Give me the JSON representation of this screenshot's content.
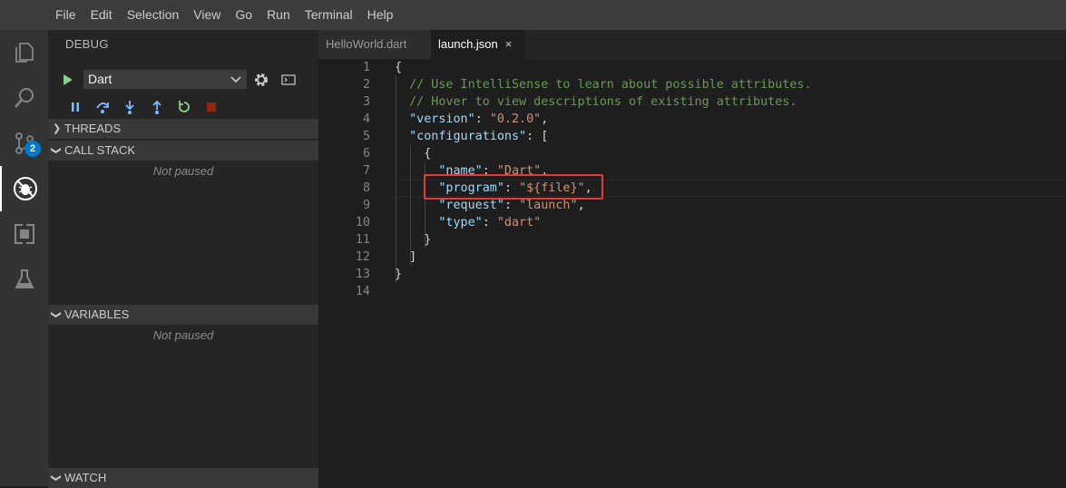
{
  "menu": [
    "File",
    "Edit",
    "Selection",
    "View",
    "Go",
    "Run",
    "Terminal",
    "Help"
  ],
  "activity": {
    "scm_badge": "2"
  },
  "sidebar": {
    "title": "DEBUG",
    "config_selected": "Dart",
    "sections": {
      "threads": "THREADS",
      "call_stack": "CALL STACK",
      "call_stack_status": "Not paused",
      "variables": "VARIABLES",
      "variables_status": "Not paused",
      "watch": "WATCH"
    }
  },
  "tabs": [
    {
      "label": "HelloWorld.dart",
      "active": false
    },
    {
      "label": "launch.json",
      "active": true,
      "close": "×"
    }
  ],
  "editor": {
    "line_numbers": [
      "1",
      "2",
      "3",
      "4",
      "5",
      "6",
      "7",
      "8",
      "9",
      "10",
      "11",
      "12",
      "13",
      "14"
    ],
    "lines": [
      "{",
      "  // Use IntelliSense to learn about possible attributes.",
      "  // Hover to view descriptions of existing attributes.",
      "  \"version\": \"0.2.0\",",
      "  \"configurations\": [",
      "    {",
      "      \"name\": \"Dart\",",
      "      \"program\": \"${file}\",",
      "      \"request\": \"launch\",",
      "      \"type\": \"dart\"",
      "    }",
      "  ]",
      "}",
      ""
    ]
  },
  "colors": {
    "accent": "#007acc",
    "highlight_box": "#e53935",
    "comment": "#6a9955",
    "key": "#9cdcfe",
    "string": "#ce9178"
  }
}
